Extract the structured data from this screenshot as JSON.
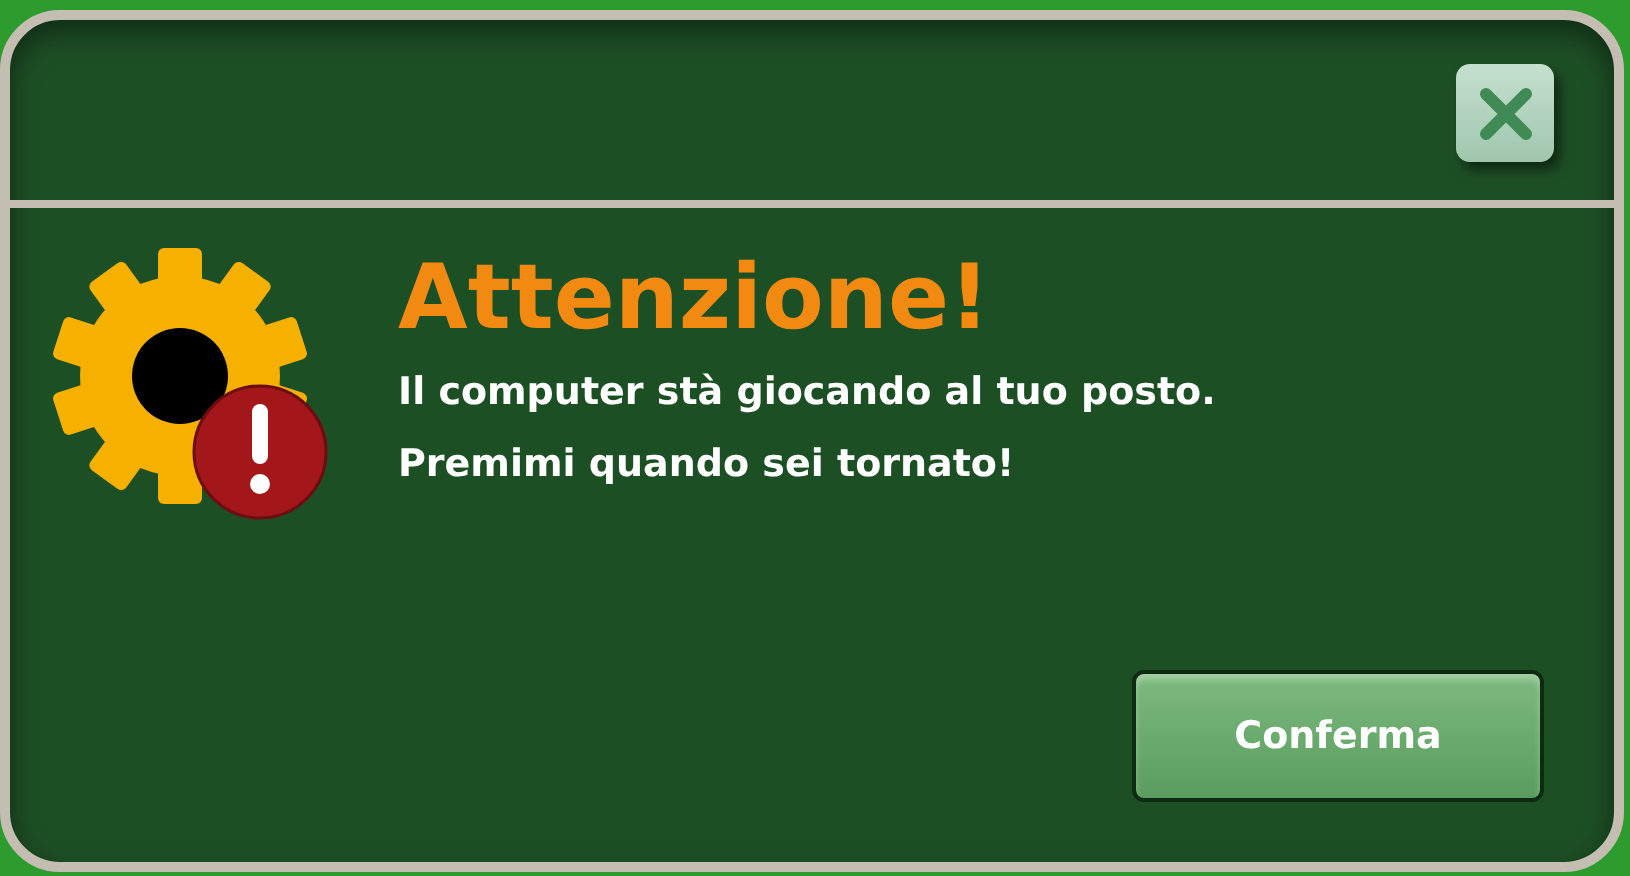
{
  "dialog": {
    "heading": "Attenzione!",
    "message": [
      "Il computer stà giocando al tuo posto.",
      "Premimi quando sei tornato!"
    ],
    "buttons": [
      {
        "label": "Conferma"
      }
    ]
  }
}
